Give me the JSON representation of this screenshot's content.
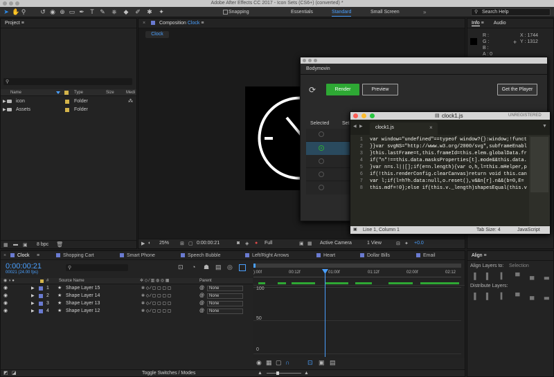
{
  "app_title": "Adobe After Effects CC 2017 - Icon Sets (CS6+) (converted) *",
  "toolbar": {
    "snapping_label": "Snapping",
    "workspaces": [
      "Essentials",
      "Standard",
      "Small Screen"
    ],
    "search_placeholder": "Search Help"
  },
  "project": {
    "title": "Project",
    "columns": [
      "Name",
      "Type",
      "Size",
      "Medi"
    ],
    "items": [
      {
        "name": "icon",
        "type": "Folder"
      },
      {
        "name": "Assets",
        "type": "Folder"
      }
    ],
    "bpc": "8 bpc"
  },
  "composition": {
    "panel_label": "Composition",
    "comp_name": "Clock",
    "tab": "Clock",
    "zoom": "25%",
    "timecode": "0:00:00:21",
    "resolution": "Full",
    "camera": "Active Camera",
    "view": "1 View",
    "exposure": "+0.0"
  },
  "info": {
    "tabs": [
      "Info",
      "Audio"
    ],
    "r": "R :",
    "g": "G :",
    "b": "B :",
    "a": "A : 0",
    "x": "X : 1744",
    "y": "Y : 1312"
  },
  "bodymovin": {
    "window_title": "Bodymovin",
    "render_label": "Render",
    "preview_label": "Preview",
    "player_label": "Get the Player",
    "col_selected": "Selected",
    "col_settings": "Set"
  },
  "editor": {
    "window_title": "clock1.js",
    "status": "UNREGISTERED",
    "tab": "clock1.js",
    "lines": [
      "var window=\"undefined\"==typeof window?{}:window;!funct",
      "}}var svgNS=\"http://www.w3.org/2000/svg\",subframeEnabl",
      "}this.lastFrame=t,this.frameId=this.elem.globalData.fr",
      "if(\"n\"!==this.data.masksProperties[t].mode&&this.data.",
      "}var n=s.l||[];if(e=n.length){var o,h,l=this.mHelper,p",
      "if(!this.renderConfig.clearCanvas)return void this.can",
      "var l;if(l=h?h.data:null,o.reset(),v&&n[r].n&&(b=0,E=",
      "this.mdf=!0};else if(this.v._length)shapesEqual(this.v"
    ],
    "cursor": "Line 1, Column 1",
    "tab_size": "Tab Size: 4",
    "language": "JavaScript"
  },
  "timeline": {
    "tabs": [
      "Clock",
      "Shopping Cart",
      "Smart Phone",
      "Speech Bubble",
      "Left/Right Arrows",
      "Heart",
      "Dollar Bills",
      "Email"
    ],
    "timecode": "0:00:00:21",
    "fps": "00021 (24.00 fps)",
    "col_num": "#",
    "col_source": "Source Name",
    "col_parent": "Parent",
    "layers": [
      {
        "num": "1",
        "name": "Shape Layer 15",
        "parent": "None"
      },
      {
        "num": "2",
        "name": "Shape Layer 14",
        "parent": "None"
      },
      {
        "num": "3",
        "name": "Shape Layer 13",
        "parent": "None"
      },
      {
        "num": "4",
        "name": "Shape Layer 12",
        "parent": "None"
      }
    ],
    "ruler": [
      "):00f",
      "00:12f",
      "01:00f",
      "01:12f",
      "02:00f",
      "02:12"
    ],
    "graph_labels": [
      "100",
      "50",
      "0"
    ],
    "toggle_label": "Toggle Switches / Modes"
  },
  "align": {
    "title": "Align",
    "align_to": "Align Layers to:",
    "align_to_value": "Selection",
    "distribute": "Distribute Layers:"
  },
  "colors": {
    "accent_blue": "#2d8ceb",
    "render_green": "#2ea834",
    "label_blue": "#6a7bd1"
  }
}
